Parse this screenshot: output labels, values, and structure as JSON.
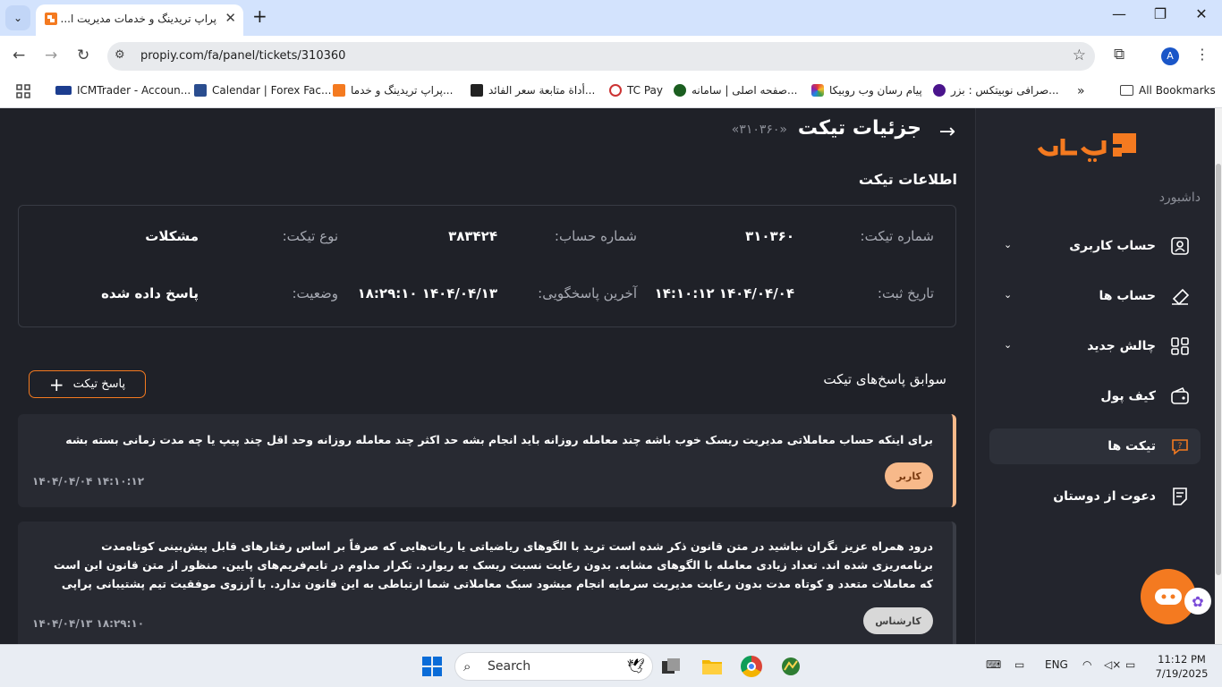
{
  "browser": {
    "tab_title": "پراپ تریدینگ و خدمات مدیریت ا...",
    "url": "propiy.com/fa/panel/tickets/310360",
    "profile_initial": "A",
    "bookmarks": [
      {
        "label": "ICMTrader - Accoun...",
        "icon": "icm-icon"
      },
      {
        "label": "Calendar | Forex Fac...",
        "icon": "forexfactory-icon"
      },
      {
        "label": "پراپ تریدینگ و خدما...",
        "icon": "propiy-icon"
      },
      {
        "label": "أداة متابعة سعر الفائد...",
        "icon": "investing-icon"
      },
      {
        "label": "TC Pay",
        "icon": "tcpay-icon"
      },
      {
        "label": "صفحه اصلی | سامانه...",
        "icon": "emblem-icon"
      },
      {
        "label": "پیام رسان وب روبیکا",
        "icon": "rubika-icon"
      },
      {
        "label": "صرافی نوبیتکس : بزر...",
        "icon": "nobitex-icon"
      }
    ],
    "all_bookmarks": "All Bookmarks"
  },
  "sidebar": {
    "dashboard_label": "داشبورد",
    "items": [
      {
        "label": "حساب کاربری",
        "icon": "user-icon",
        "has_chevron": true
      },
      {
        "label": "حساب ها",
        "icon": "accounts-icon",
        "has_chevron": true
      },
      {
        "label": "چالش جدید",
        "icon": "grid-icon",
        "has_chevron": true
      },
      {
        "label": "کیف پول",
        "icon": "wallet-icon",
        "has_chevron": false
      },
      {
        "label": "تیکت ها",
        "icon": "ticket-icon",
        "has_chevron": false,
        "active": true
      },
      {
        "label": "دعوت از دوستان",
        "icon": "invite-icon",
        "has_chevron": false
      }
    ]
  },
  "header": {
    "title": "جزئیات تیکت",
    "ticket_ref": "«۳۱۰۳۶۰»"
  },
  "info": {
    "section_title": "اطلاعات تیکت",
    "ticket_number_label": "شماره تیکت:",
    "ticket_number": "۳۱۰۳۶۰",
    "account_number_label": "شماره حساب:",
    "account_number": "۳۸۳۴۲۴",
    "ticket_type_label": "نوع تیکت:",
    "ticket_type": "مشکلات",
    "created_label": "تاریخ ثبت:",
    "created": "۱۴۰۴/۰۴/۰۴ ۱۴:۱۰:۱۲",
    "last_response_label": "آخرین پاسخگویی:",
    "last_response": "۱۴۰۴/۰۴/۱۳ ۱۸:۲۹:۱۰",
    "status_label": "وضعیت:",
    "status": "پاسخ داده شده"
  },
  "history": {
    "title": "سوابق پاسخ‌های تیکت",
    "reply_button": "پاسخ تیکت",
    "messages": [
      {
        "text": "برای اینکه حساب معاملاتی مدیریت ریسک خوب باشه چند معامله روزانه باید انجام بشه حد اکثر چند معامله روزانه وحد اقل چند پیپ یا چه مدت زمانی بسته بشه",
        "badge": "کاربر",
        "date": "۱۴۰۴/۰۴/۰۴ ۱۴:۱۰:۱۲"
      },
      {
        "text": "درود همراه عزیز نگران نباشید در متن قانون ذکر شده است ترید با الگوهای ریاضیاتی یا ربات‌هایی که صرفاً بر اساس رفتارهای قابل پیش‌بینی کوتاه‌مدت برنامه‌ریزی شده اند. تعداد زیادی معامله با الگوهای مشابه. بدون رعایت نسبت ریسک به ریوارد. تکرار مداوم در تایم‌فریم‌های پایین. منظور از متن قانون این است که معاملات متعدد و کوتاه مدت بدون رعایت مدیریت سرمایه انجام میشود سبک معاملاتی شما ارتباطی به این قانون ندارد. با آرزوی موفقیت تیم پشتیبانی پراپی",
        "badge": "کارشناس",
        "date": "۱۴۰۴/۰۴/۱۳ ۱۸:۲۹:۱۰"
      }
    ]
  },
  "taskbar": {
    "search_placeholder": "Search",
    "lang": "ENG",
    "time": "11:12 PM",
    "date": "7/19/2025"
  },
  "colors": {
    "brand_orange": "#f47a20",
    "page_bg": "#1f2128",
    "user_badge": "#f7b98a",
    "expert_badge": "#d8d8d8"
  }
}
